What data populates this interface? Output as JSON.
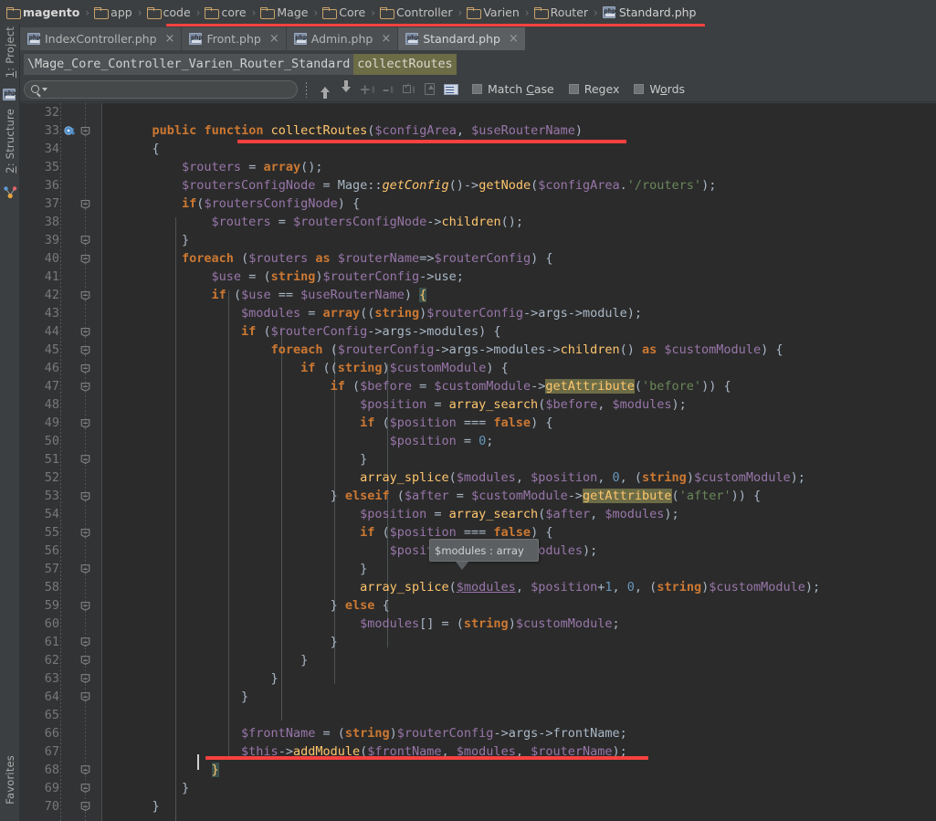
{
  "breadcrumb": {
    "items": [
      {
        "label": "magento",
        "icon": "folder-icon"
      },
      {
        "label": "app",
        "icon": "folder-icon"
      },
      {
        "label": "code",
        "icon": "folder-icon"
      },
      {
        "label": "core",
        "icon": "folder-icon"
      },
      {
        "label": "Mage",
        "icon": "folder-icon"
      },
      {
        "label": "Core",
        "icon": "folder-icon"
      },
      {
        "label": "Controller",
        "icon": "folder-icon"
      },
      {
        "label": "Varien",
        "icon": "folder-icon"
      },
      {
        "label": "Router",
        "icon": "folder-icon"
      },
      {
        "label": "Standard.php",
        "icon": "php-file-icon"
      }
    ],
    "separator": "›"
  },
  "tabs": [
    {
      "label": "IndexController.php",
      "active": false,
      "close": "×"
    },
    {
      "label": "Front.php",
      "active": false,
      "close": "×"
    },
    {
      "label": "Admin.php",
      "active": false,
      "close": "×"
    },
    {
      "label": "Standard.php",
      "active": true,
      "close": "×"
    }
  ],
  "navbar": {
    "class_path": "\\Mage_Core_Controller_Varien_Router_Standard",
    "member": "collectRoutes"
  },
  "findbar": {
    "placeholder": "",
    "value": "",
    "search_icon": "search-icon",
    "checkboxes": [
      {
        "label": "Match Case",
        "checked": false
      },
      {
        "label": "Regex",
        "checked": false
      },
      {
        "label": "Words",
        "checked": false
      }
    ],
    "buttons": [
      {
        "name": "find-previous-button",
        "icon": "arrow-up-icon"
      },
      {
        "name": "find-next-button",
        "icon": "arrow-down-icon"
      },
      {
        "name": "add-selection-button",
        "icon": "plus-selection-icon"
      },
      {
        "name": "remove-selection-button",
        "icon": "minus-selection-icon"
      },
      {
        "name": "select-all-occurrences-button",
        "icon": "select-all-icon"
      },
      {
        "name": "open-in-find-window-button",
        "icon": "export-icon"
      },
      {
        "name": "filter-button",
        "icon": "list-icon"
      }
    ]
  },
  "left_strip": {
    "project": "1: Project",
    "structure": "2: Structure",
    "favorites": "Favorites"
  },
  "editor": {
    "first_line": 32,
    "caret_line": 68,
    "lines": [
      {
        "n": 32,
        "text": ""
      },
      {
        "n": 33,
        "text": "    public function collectRoutes($configArea, $useRouterName)"
      },
      {
        "n": 34,
        "text": "    {"
      },
      {
        "n": 35,
        "text": "        $routers = array();"
      },
      {
        "n": 36,
        "text": "        $routersConfigNode = Mage::getConfig()->getNode($configArea.'/routers');"
      },
      {
        "n": 37,
        "text": "        if($routersConfigNode) {"
      },
      {
        "n": 38,
        "text": "            $routers = $routersConfigNode->children();"
      },
      {
        "n": 39,
        "text": "        }"
      },
      {
        "n": 40,
        "text": "        foreach ($routers as $routerName=>$routerConfig) {"
      },
      {
        "n": 41,
        "text": "            $use = (string)$routerConfig->use;"
      },
      {
        "n": 42,
        "text": "            if ($use == $useRouterName) {"
      },
      {
        "n": 43,
        "text": "                $modules = array((string)$routerConfig->args->module);"
      },
      {
        "n": 44,
        "text": "                if ($routerConfig->args->modules) {"
      },
      {
        "n": 45,
        "text": "                    foreach ($routerConfig->args->modules->children() as $customModule) {"
      },
      {
        "n": 46,
        "text": "                        if ((string)$customModule) {"
      },
      {
        "n": 47,
        "text": "                            if ($before = $customModule->getAttribute('before')) {"
      },
      {
        "n": 48,
        "text": "                                $position = array_search($before, $modules);"
      },
      {
        "n": 49,
        "text": "                                if ($position === false) {"
      },
      {
        "n": 50,
        "text": "                                    $position = 0;"
      },
      {
        "n": 51,
        "text": "                                }"
      },
      {
        "n": 52,
        "text": "                                array_splice($modules, $position, 0, (string)$customModule);"
      },
      {
        "n": 53,
        "text": "                            } elseif ($after = $customModule->getAttribute('after')) {"
      },
      {
        "n": 54,
        "text": "                                $position = array_search($after, $modules);"
      },
      {
        "n": 55,
        "text": "                                if ($position === false) {"
      },
      {
        "n": 56,
        "text": "                                    $position = count($modules);"
      },
      {
        "n": 57,
        "text": "                                }"
      },
      {
        "n": 58,
        "text": "                                array_splice($modules, $position+1, 0, (string)$customModule);"
      },
      {
        "n": 59,
        "text": "                            } else {"
      },
      {
        "n": 60,
        "text": "                                $modules[] = (string)$customModule;"
      },
      {
        "n": 61,
        "text": "                            }"
      },
      {
        "n": 62,
        "text": "                        }"
      },
      {
        "n": 63,
        "text": "                    }"
      },
      {
        "n": 64,
        "text": "                }"
      },
      {
        "n": 65,
        "text": ""
      },
      {
        "n": 66,
        "text": "                $frontName = (string)$routerConfig->args->frontName;"
      },
      {
        "n": 67,
        "text": "                $this->addModule($frontName, $modules, $routerName);"
      },
      {
        "n": 68,
        "text": "            }"
      },
      {
        "n": 69,
        "text": "        }"
      },
      {
        "n": 70,
        "text": "    }"
      }
    ],
    "search_highlight": "getAttribute",
    "tooltip": "$modules : array",
    "colors": {
      "background": "#2b2b2b",
      "gutter": "#313335",
      "keyword": "#cc7832",
      "variable": "#9876aa",
      "string": "#6a8759",
      "number": "#6897bb",
      "function": "#ffc66d",
      "default_text": "#a9b7c6",
      "search_highlight": "#6c6c46",
      "annotation_red": "#f5413f"
    }
  }
}
